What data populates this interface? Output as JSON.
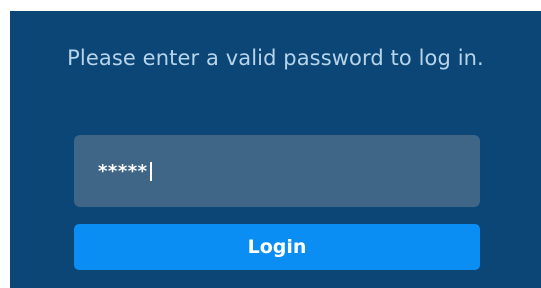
{
  "login": {
    "message": "Please enter a valid password to log in.",
    "password_value": "*****",
    "button_label": "Login"
  },
  "colors": {
    "panel_background": "#0b4677",
    "field_background": "#3f6687",
    "button_background": "#0b8ef3",
    "message_text": "#b6d4ea"
  }
}
